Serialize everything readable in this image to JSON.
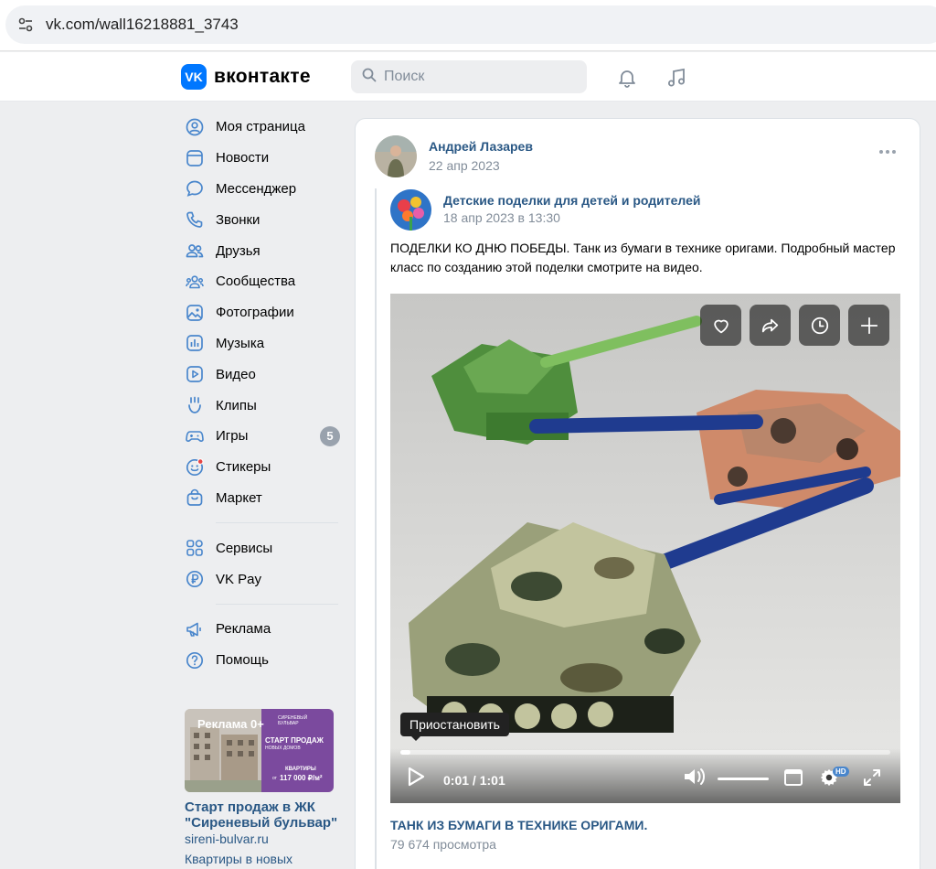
{
  "browser": {
    "url": "vk.com/wall16218881_3743"
  },
  "header": {
    "logo_mark": "VK",
    "logo_text": "вконтакте",
    "search_placeholder": "Поиск"
  },
  "sidebar": {
    "items": [
      {
        "label": "Моя страница",
        "icon": "user-circle-icon"
      },
      {
        "label": "Новости",
        "icon": "news-icon"
      },
      {
        "label": "Мессенджер",
        "icon": "message-icon"
      },
      {
        "label": "Звонки",
        "icon": "phone-icon"
      },
      {
        "label": "Друзья",
        "icon": "friends-icon"
      },
      {
        "label": "Сообщества",
        "icon": "communities-icon"
      },
      {
        "label": "Фотографии",
        "icon": "photo-icon"
      },
      {
        "label": "Музыка",
        "icon": "music-icon"
      },
      {
        "label": "Видео",
        "icon": "video-icon"
      },
      {
        "label": "Клипы",
        "icon": "clips-icon"
      },
      {
        "label": "Игры",
        "icon": "gamepad-icon",
        "badge": "5"
      },
      {
        "label": "Стикеры",
        "icon": "smile-icon"
      },
      {
        "label": "Маркет",
        "icon": "bag-icon"
      }
    ],
    "items2": [
      {
        "label": "Сервисы",
        "icon": "services-icon"
      },
      {
        "label": "VK Pay",
        "icon": "ruble-icon"
      }
    ],
    "items3": [
      {
        "label": "Реклама",
        "icon": "megaphone-icon"
      },
      {
        "label": "Помощь",
        "icon": "help-icon"
      }
    ]
  },
  "ad": {
    "overlay_label": "Реклама 0+",
    "brand": "СИРЕНЕВЫЙ БУЛЬВАР",
    "headline": "СТАРТ ПРОДАЖ",
    "subline": "НОВЫХ ДОМОВ",
    "price_label": "КВАРТИРЫ",
    "price_from": "от",
    "price": "117 000 ₽/м²",
    "title": "Старт продаж в ЖК \"Сиреневый бульвар\"",
    "domain": "sireni-bulvar.ru",
    "description": "Квартиры в новых"
  },
  "post": {
    "author": "Андрей Лазарев",
    "date": "22 апр 2023",
    "repost": {
      "group": "Детские поделки для детей и родителей",
      "date": "18 апр 2023 в 13:30",
      "text": "ПОДЕЛКИ КО ДНЮ ПОБЕДЫ. Танк из бумаги в технике оригами. Подробный мастер класс по созданию этой поделки смотрите на видео."
    },
    "video": {
      "tooltip": "Приостановить",
      "time_current": "0:01",
      "time_sep": "/",
      "time_total": "1:01",
      "hd_label": "HD",
      "progress": 0.02,
      "title": "ТАНК ИЗ БУМАГИ В ТЕХНИКЕ ОРИГАМИ.",
      "views": "79 674 просмотра"
    }
  },
  "colors": {
    "accent": "#0077ff",
    "link": "#2a5885",
    "muted": "#818c99",
    "icon": "#4986cc",
    "bg": "#edeef0"
  }
}
